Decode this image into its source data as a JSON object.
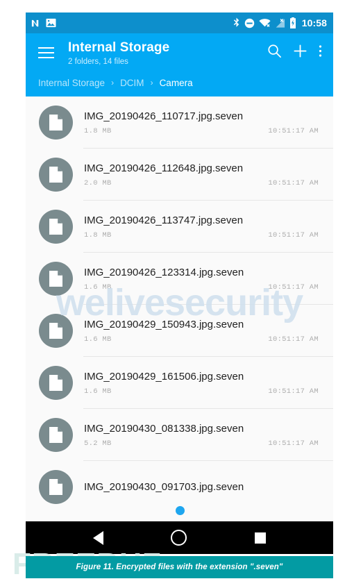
{
  "status_bar": {
    "left_icons": [
      "android-n-logo-icon",
      "photos-notification-icon"
    ],
    "right_icons": [
      "bluetooth-icon",
      "do-not-disturb-icon",
      "wifi-off-icon",
      "signal-off-icon",
      "battery-icon"
    ],
    "clock": "10:58",
    "background_color": "#0d8fcc"
  },
  "app_bar": {
    "menu_icon": "hamburger-menu-icon",
    "title": "Internal Storage",
    "subtitle": "2 folders, 14 files",
    "actions": [
      {
        "name": "search-icon",
        "label": "Search"
      },
      {
        "name": "add-icon",
        "label": "Add"
      },
      {
        "name": "overflow-menu-icon",
        "label": "More options"
      }
    ],
    "background_color": "#03a9f4"
  },
  "breadcrumb": {
    "separator": "›",
    "items": [
      {
        "label": "Internal Storage",
        "current": false
      },
      {
        "label": "DCIM",
        "current": false
      },
      {
        "label": "Camera",
        "current": true
      }
    ]
  },
  "file_list": {
    "icon_name": "file-document-icon",
    "icon_color": "#7a8b8e",
    "rows": [
      {
        "name": "IMG_20190426_110717.jpg.seven",
        "size": "1.8 MB",
        "time": "10:51:17 AM"
      },
      {
        "name": "IMG_20190426_112648.jpg.seven",
        "size": "2.0 MB",
        "time": "10:51:17 AM"
      },
      {
        "name": "IMG_20190426_113747.jpg.seven",
        "size": "1.8 MB",
        "time": "10:51:17 AM"
      },
      {
        "name": "IMG_20190426_123314.jpg.seven",
        "size": "1.6 MB",
        "time": "10:51:17 AM"
      },
      {
        "name": "IMG_20190429_150943.jpg.seven",
        "size": "1.6 MB",
        "time": "10:51:17 AM"
      },
      {
        "name": "IMG_20190429_161506.jpg.seven",
        "size": "1.6 MB",
        "time": "10:51:17 AM"
      },
      {
        "name": "IMG_20190430_081338.jpg.seven",
        "size": "5.2 MB",
        "time": "10:51:17 AM"
      },
      {
        "name": "IMG_20190430_091703.jpg.seven",
        "size": "",
        "time": ""
      }
    ]
  },
  "watermarks": {
    "site": "welivesecurity",
    "site_color": "#cfe0ee",
    "publisher": "FREEBUF",
    "publisher_color": "#d9ece9"
  },
  "nav_bar": {
    "back": "back-triangle-icon",
    "home": "home-circle-icon",
    "recents": "recents-square-icon"
  },
  "caption": {
    "text": "Figure 11. Encrypted files with the extension \".seven\"",
    "background_color": "#039ba3"
  }
}
